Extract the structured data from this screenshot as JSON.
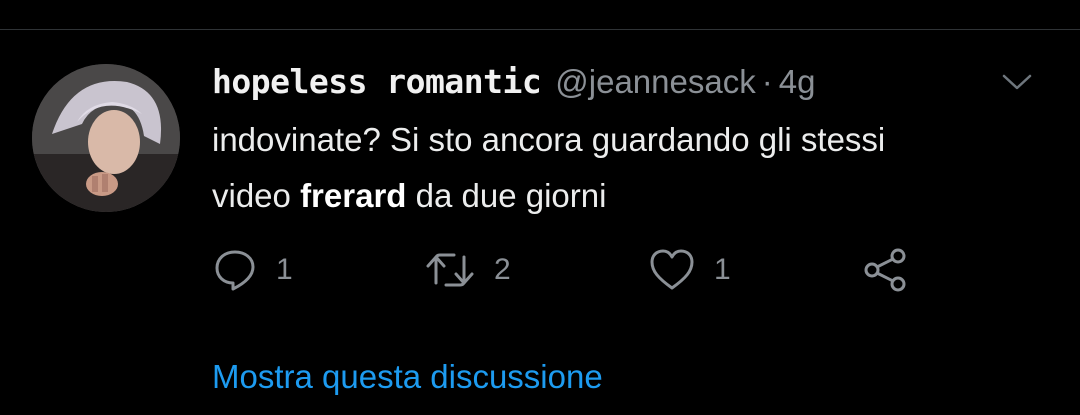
{
  "tweet": {
    "display_name": "hopeless romantic",
    "handle": "@jeannesack",
    "separator": "·",
    "time": "4g",
    "text_line1": "indovinate? Si sto ancora guardando gli stessi",
    "text_line2_pre": "video ",
    "text_line2_bold": "frerard",
    "text_line2_post": " da due giorni"
  },
  "actions": {
    "reply_count": "1",
    "retweet_count": "2",
    "like_count": "1"
  },
  "icons": {
    "reply": "reply-icon",
    "retweet": "retweet-icon",
    "like": "heart-icon",
    "share": "share-icon",
    "menu": "chevron-down-icon"
  },
  "show_thread_label": "Mostra questa discussione",
  "colors": {
    "background": "#000000",
    "text": "#eceded",
    "muted": "#8b9096",
    "link": "#1d9bf0",
    "divider": "#2f3336"
  }
}
